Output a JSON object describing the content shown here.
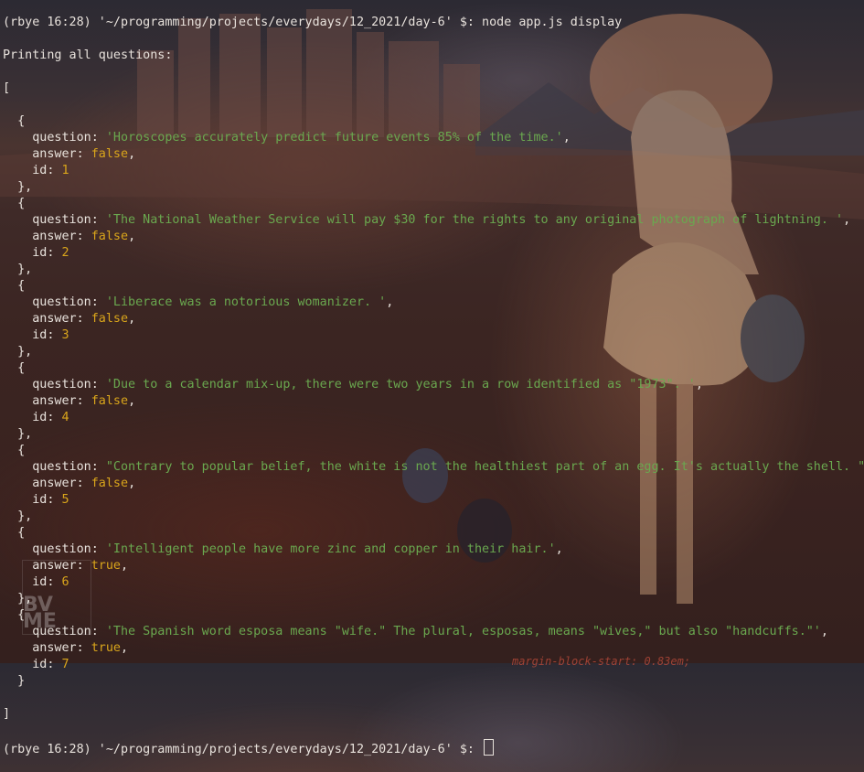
{
  "prompt": "(rbye 16:28) '~/programming/projects/everydays/12_2021/day-6' $:",
  "command": "node app.js display",
  "header": "Printing all questions:",
  "open_bracket": "[",
  "close_bracket": "]",
  "labels": {
    "question": "question:",
    "answer": "answer:",
    "id": "id:"
  },
  "entries": [
    {
      "question": "'Horoscopes accurately predict future events 85% of the time.'",
      "answer": "false",
      "id": "1"
    },
    {
      "question": "'The National Weather Service will pay $30 for the rights to any original photograph of lightning. '",
      "answer": "false",
      "id": "2"
    },
    {
      "question": "'Liberace was a notorious womanizer. '",
      "answer": "false",
      "id": "3"
    },
    {
      "question": "'Due to a calendar mix-up, there were two years in a row identified as \"1973\". '",
      "answer": "false",
      "id": "4"
    },
    {
      "question": "\"Contrary to popular belief, the white is not the healthiest part of an egg. It's actually the shell. \"",
      "answer": "false",
      "id": "5"
    },
    {
      "question": "'Intelligent people have more zinc and copper in their hair.'",
      "answer": "true",
      "id": "6"
    },
    {
      "question": "'The Spanish word esposa means \"wife.\" The plural, esposas, means \"wives,\" but also \"handcuffs.\"'",
      "answer": "true",
      "id": "7"
    }
  ],
  "overlay_text": "margin-block-start: 0.83em;",
  "watermark": "BV ME",
  "colors": {
    "string": "#6aa84f",
    "boolean": "#d9a51b",
    "number": "#d9a51b",
    "text": "#e8e2dc"
  }
}
